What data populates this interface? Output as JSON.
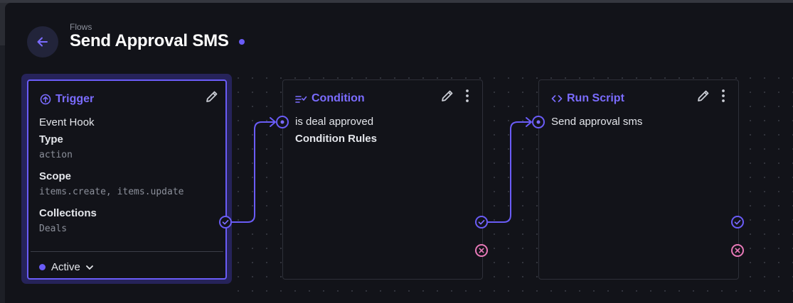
{
  "header": {
    "breadcrumb": "Flows",
    "title": "Send Approval SMS",
    "back_icon": "arrow-left-icon"
  },
  "colors": {
    "accent": "#6a5cf7",
    "reject": "#e879b8",
    "background": "#121319",
    "card_border": "#2e3039"
  },
  "trigger": {
    "title": "Trigger",
    "icon": "trigger-circle-icon",
    "event_label": "Event Hook",
    "type_label": "Type",
    "type_value": "action",
    "scope_label": "Scope",
    "scope_value": "items.create, items.update",
    "collections_label": "Collections",
    "collections_value": "Deals",
    "status": "Active"
  },
  "condition": {
    "title": "Condition",
    "icon": "rule-check-icon",
    "name": "is deal approved",
    "detail_label": "Condition Rules"
  },
  "run_script": {
    "title": "Run Script",
    "icon": "code-brackets-icon",
    "name": "Send approval sms"
  }
}
